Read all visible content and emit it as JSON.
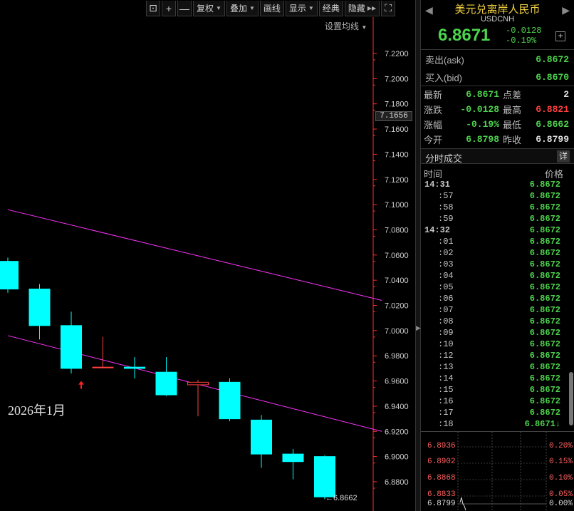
{
  "toolbar": {
    "lock_icon": "lock-icon",
    "zoom_in": "+",
    "zoom_out": "—",
    "restore_rights": "复权",
    "overlay": "叠加",
    "draw_line": "画线",
    "display": "显示",
    "classic": "经典",
    "hide": "隐藏",
    "expand_icon": "expand-icon"
  },
  "ma_setting": "设置均线",
  "chart_data": {
    "type": "candlestick",
    "title": "",
    "y_ticks": [
      "7.2200",
      "7.2000",
      "7.1800",
      "7.1600",
      "7.1400",
      "7.1200",
      "7.1000",
      "7.0800",
      "7.0600",
      "7.0400",
      "7.0200",
      "7.0000",
      "6.9800",
      "6.9600",
      "6.9400",
      "6.9200",
      "6.9000",
      "6.8800"
    ],
    "ylim": [
      6.862,
      7.232
    ],
    "current_price_tag": "7.1656",
    "low_label": "←6.8662",
    "month_label": "2026年1月",
    "candles": [
      {
        "open": 7.055,
        "close": 7.033,
        "high": 7.058,
        "low": 7.03
      },
      {
        "open": 7.033,
        "close": 7.004,
        "high": 7.037,
        "low": 6.993
      },
      {
        "open": 7.004,
        "close": 6.97,
        "high": 7.015,
        "low": 6.966
      },
      {
        "open": 6.971,
        "close": 6.971,
        "high": 6.995,
        "low": 6.97
      },
      {
        "open": 6.971,
        "close": 6.97,
        "high": 6.979,
        "low": 6.962
      },
      {
        "open": 6.967,
        "close": 6.949,
        "high": 6.979,
        "low": 6.948
      },
      {
        "open": 6.957,
        "close": 6.959,
        "high": 6.961,
        "low": 6.932
      },
      {
        "open": 6.959,
        "close": 6.93,
        "high": 6.962,
        "low": 6.928
      },
      {
        "open": 6.929,
        "close": 6.902,
        "high": 6.933,
        "low": 6.891
      },
      {
        "open": 6.902,
        "close": 6.896,
        "high": 6.906,
        "low": 6.882
      },
      {
        "open": 6.9,
        "close": 6.868,
        "high": 6.901,
        "low": 6.8662
      }
    ],
    "trend_lines": [
      {
        "from": [
          0,
          7.096
        ],
        "to": [
          11.8,
          7.024
        ]
      },
      {
        "from": [
          0,
          6.996
        ],
        "to": [
          11.8,
          6.92
        ]
      }
    ],
    "colors": {
      "up": "#ff4040",
      "down": "#00ffff",
      "trend": "#ff33ff",
      "axis": "#ff3030"
    }
  },
  "quote": {
    "title": "美元兑离岸人民币",
    "code": "USDCNH",
    "price": "6.8671",
    "change": "-0.0128",
    "change_pct": "-0.19%",
    "ask_label": "卖出(ask)",
    "ask": "6.8672",
    "bid_label": "买入(bid)",
    "bid": "6.8670",
    "stats": [
      {
        "l1": "最新",
        "v1": "6.8671",
        "c1": "grn",
        "l2": "点差",
        "v2": "2",
        "c2": "wht"
      },
      {
        "l1": "涨跌",
        "v1": "-0.0128",
        "c1": "grn",
        "l2": "最高",
        "v2": "6.8821",
        "c2": "red"
      },
      {
        "l1": "涨幅",
        "v1": "-0.19%",
        "c1": "grn",
        "l2": "最低",
        "v2": "6.8662",
        "c2": "grn"
      },
      {
        "l1": "今开",
        "v1": "6.8798",
        "c1": "grn",
        "l2": "昨收",
        "v2": "6.8799",
        "c2": "wht"
      }
    ]
  },
  "trades": {
    "title": "分时成交",
    "detail": "详",
    "col_time": "时间",
    "col_price": "价格",
    "rows": [
      {
        "t": "14:31",
        "p": "6.8672"
      },
      {
        "t": ":57",
        "p": "6.8672"
      },
      {
        "t": ":58",
        "p": "6.8672"
      },
      {
        "t": ":59",
        "p": "6.8672"
      },
      {
        "t": "14:32",
        "p": "6.8672"
      },
      {
        "t": ":01",
        "p": "6.8672"
      },
      {
        "t": ":02",
        "p": "6.8672"
      },
      {
        "t": ":03",
        "p": "6.8672"
      },
      {
        "t": ":04",
        "p": "6.8672"
      },
      {
        "t": ":05",
        "p": "6.8672"
      },
      {
        "t": ":06",
        "p": "6.8672"
      },
      {
        "t": ":07",
        "p": "6.8672"
      },
      {
        "t": ":08",
        "p": "6.8672"
      },
      {
        "t": ":09",
        "p": "6.8672"
      },
      {
        "t": ":10",
        "p": "6.8672"
      },
      {
        "t": ":12",
        "p": "6.8672"
      },
      {
        "t": ":13",
        "p": "6.8672"
      },
      {
        "t": ":14",
        "p": "6.8672"
      },
      {
        "t": ":15",
        "p": "6.8672"
      },
      {
        "t": ":16",
        "p": "6.8672"
      },
      {
        "t": ":17",
        "p": "6.8672"
      },
      {
        "t": ":18",
        "p": "6.8671↓"
      }
    ]
  },
  "mini_chart": {
    "left_labels": [
      "6.8936",
      "6.8902",
      "6.8868",
      "6.8833",
      "6.8799"
    ],
    "right_labels": [
      "0.20%",
      "0.15%",
      "0.10%",
      "0.05%",
      "0.00%"
    ]
  }
}
